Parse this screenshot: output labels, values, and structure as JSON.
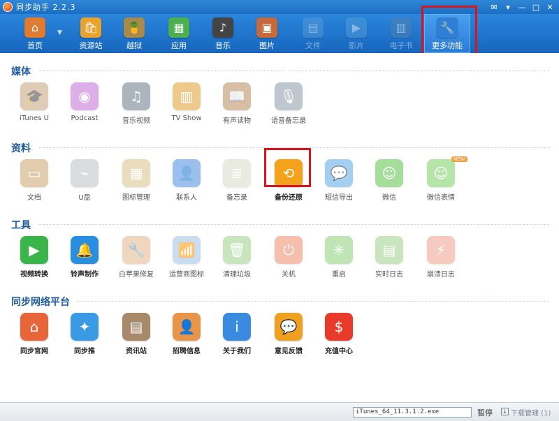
{
  "window": {
    "title": "同步助手 2.2.3",
    "controls": [
      "✉",
      "▾",
      "—",
      "□",
      "✕"
    ]
  },
  "toolbar": {
    "items": [
      {
        "label": "首页",
        "icon": "home-icon",
        "color": "#e07b32"
      },
      {
        "label": "资源站",
        "icon": "shopping-bag-icon",
        "color": "#e8a22d"
      },
      {
        "label": "越狱",
        "icon": "pineapple-icon",
        "color": "#a88b4c"
      },
      {
        "label": "应用",
        "icon": "apps-icon",
        "color": "#4caf50"
      },
      {
        "label": "音乐",
        "icon": "music-icon",
        "color": "#444444"
      },
      {
        "label": "图片",
        "icon": "picture-icon",
        "color": "#c76a3b"
      },
      {
        "label": "文件",
        "icon": "file-icon",
        "color": "#5aa0d8"
      },
      {
        "label": "影片",
        "icon": "movie-icon",
        "color": "#5aa0d8"
      },
      {
        "label": "电子书",
        "icon": "ebook-icon",
        "color": "#5a7fa8"
      },
      {
        "label": "更多功能",
        "icon": "tools-icon",
        "color": "#2f7fd6"
      }
    ]
  },
  "sections": {
    "media": {
      "title": "媒体",
      "items": [
        {
          "label": "iTunes U",
          "icon": "itunes-u-icon",
          "color": "#c8a27a",
          "glyph": "🎓"
        },
        {
          "label": "Podcast",
          "icon": "podcast-icon",
          "color": "#c26fd6",
          "glyph": "◉"
        },
        {
          "label": "音乐视频",
          "icon": "music-video-icon",
          "color": "#6a7a88",
          "glyph": "♫"
        },
        {
          "label": "TV Show",
          "icon": "tv-show-icon",
          "color": "#e0a030",
          "glyph": "▥"
        },
        {
          "label": "有声读物",
          "icon": "audiobook-icon",
          "color": "#b88c5c",
          "glyph": "📖"
        },
        {
          "label": "语音备忘录",
          "icon": "voice-memo-icon",
          "color": "#8a9aa8",
          "glyph": "🎙"
        }
      ]
    },
    "data": {
      "title": "资料",
      "items": [
        {
          "label": "文档",
          "icon": "documents-icon",
          "color": "#c9a66b",
          "glyph": "▭"
        },
        {
          "label": "U盘",
          "icon": "usb-drive-icon",
          "color": "#b9c0c6",
          "glyph": "⌁"
        },
        {
          "label": "图标管理",
          "icon": "icon-manager-icon",
          "color": "#d8c28a",
          "glyph": "▦"
        },
        {
          "label": "联系人",
          "icon": "contacts-icon",
          "color": "#4b8de0",
          "glyph": "👤"
        },
        {
          "label": "备忘录",
          "icon": "notes-icon",
          "color": "#d8dcc8",
          "glyph": "≣"
        },
        {
          "label": "备份还原",
          "icon": "backup-restore-icon",
          "color": "#f4a11b",
          "glyph": "⟲"
        },
        {
          "label": "短信导出",
          "icon": "sms-export-icon",
          "color": "#5aa8e8",
          "glyph": "💬"
        },
        {
          "label": "微信",
          "icon": "wechat-icon",
          "color": "#5cc24a",
          "glyph": "☺"
        },
        {
          "label": "微信表情",
          "icon": "wechat-emoji-icon",
          "color": "#7cd064",
          "glyph": "☺",
          "badge": "NEW"
        }
      ]
    },
    "tools": {
      "title": "工具",
      "items": [
        {
          "label": "视频转换",
          "icon": "video-convert-icon",
          "color": "#3ab54a",
          "glyph": "▶",
          "bold": true
        },
        {
          "label": "铃声制作",
          "icon": "ringtone-icon",
          "color": "#2a8ee0",
          "glyph": "🔔",
          "bold": true
        },
        {
          "label": "白苹果修复",
          "icon": "white-apple-repair-icon",
          "color": "#e4b58a",
          "glyph": "🔧"
        },
        {
          "label": "运营商图标",
          "icon": "carrier-icon",
          "color": "#9ec2e6",
          "glyph": "📶"
        },
        {
          "label": "清理垃圾",
          "icon": "trash-cleaner-icon",
          "color": "#9ed08a",
          "glyph": "🗑"
        },
        {
          "label": "关机",
          "icon": "power-off-icon",
          "color": "#f08a6a",
          "glyph": "⏻"
        },
        {
          "label": "重启",
          "icon": "restart-icon",
          "color": "#8ed07a",
          "glyph": "✳"
        },
        {
          "label": "实时日志",
          "icon": "realtime-log-icon",
          "color": "#9ed08a",
          "glyph": "▤"
        },
        {
          "label": "崩溃日志",
          "icon": "crash-log-icon",
          "color": "#f0a08a",
          "glyph": "⚡"
        }
      ]
    },
    "network": {
      "title": "同步网络平台",
      "items": [
        {
          "label": "同步官网",
          "icon": "official-site-icon",
          "color": "#e8653a",
          "glyph": "⌂",
          "bold": true
        },
        {
          "label": "同步推",
          "icon": "tongbu-push-icon",
          "color": "#3a9ae4",
          "glyph": "✦",
          "bold": true
        },
        {
          "label": "资讯站",
          "icon": "news-icon",
          "color": "#a88a6a",
          "glyph": "▤",
          "bold": true
        },
        {
          "label": "招聘信息",
          "icon": "recruitment-icon",
          "color": "#e8954a",
          "glyph": "👤",
          "bold": true
        },
        {
          "label": "关于我们",
          "icon": "about-us-icon",
          "color": "#3a8ae0",
          "glyph": "i",
          "bold": true
        },
        {
          "label": "意见反馈",
          "icon": "feedback-icon",
          "color": "#f0a020",
          "glyph": "💬",
          "bold": true
        },
        {
          "label": "充值中心",
          "icon": "recharge-icon",
          "color": "#e83a2a",
          "glyph": "$",
          "bold": true
        }
      ]
    }
  },
  "statusbar": {
    "download_file": "iTunes_64_11.3.1.2.exe",
    "pause_label": "暂停",
    "download_manager": "下载管理 (1)"
  }
}
